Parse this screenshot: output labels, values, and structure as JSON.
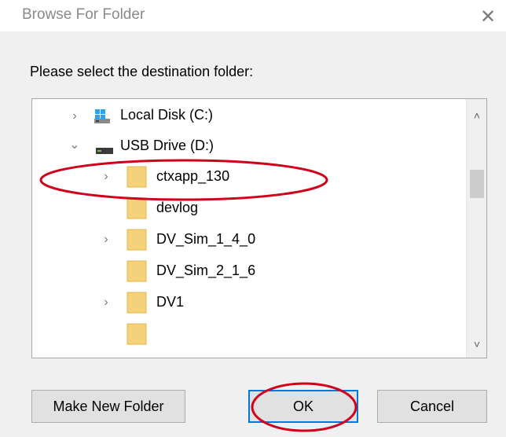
{
  "dialog": {
    "title": "Browse For Folder",
    "instruction": "Please select the destination folder:"
  },
  "tree": {
    "items": [
      {
        "label": "Local Disk (C:)",
        "type": "drive",
        "expander": "collapsed"
      },
      {
        "label": "USB Drive (D:)",
        "type": "drive",
        "expander": "expanded"
      },
      {
        "label": "ctxapp_130",
        "type": "folder",
        "expander": "collapsed"
      },
      {
        "label": "devlog",
        "type": "folder",
        "expander": "none"
      },
      {
        "label": "DV_Sim_1_4_0",
        "type": "folder",
        "expander": "collapsed"
      },
      {
        "label": "DV_Sim_2_1_6",
        "type": "folder",
        "expander": "none"
      },
      {
        "label": "DV1",
        "type": "folder",
        "expander": "collapsed"
      }
    ]
  },
  "buttons": {
    "make_new_folder": "Make New Folder",
    "ok": "OK",
    "cancel": "Cancel"
  },
  "colors": {
    "annotation": "#d0021b",
    "folder": "#f5d27a",
    "accent": "#0078d7"
  },
  "icons": {
    "close": "close-icon",
    "expand": "chevron-right-icon",
    "collapse": "chevron-down-icon",
    "drive": "drive-icon",
    "folder": "folder-icon"
  }
}
